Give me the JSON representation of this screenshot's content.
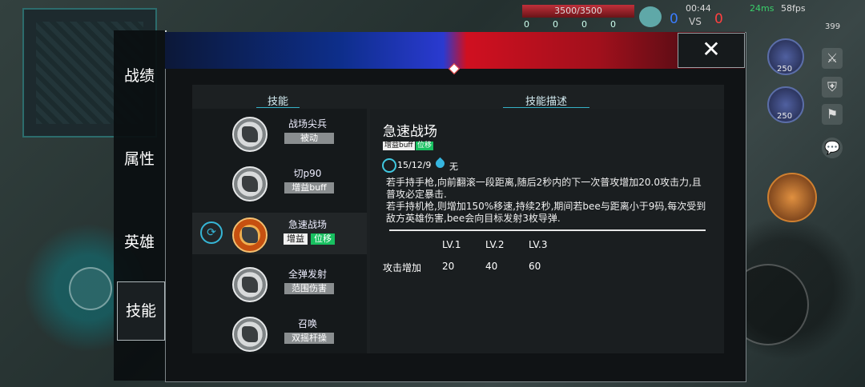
{
  "hud": {
    "hp": "3500/3500",
    "time": "00:44",
    "ping": "24ms",
    "fps": "58fps",
    "score_blue": "0",
    "vs": "VS",
    "score_red": "0",
    "stats": [
      "0",
      "0",
      "0",
      "0"
    ],
    "currency": "399",
    "hero1_level": "250",
    "hero2_level": "250"
  },
  "left_menu": {
    "items": [
      {
        "label": "战绩"
      },
      {
        "label": "属性"
      },
      {
        "label": "英雄"
      },
      {
        "label": "技能"
      }
    ]
  },
  "close_label": "✕",
  "tabs": {
    "skills": "技能",
    "description": "技能描述"
  },
  "skills": [
    {
      "name": "战场尖兵",
      "tags": [
        "被动"
      ]
    },
    {
      "name": "切p90",
      "tags": [
        "增益buff"
      ]
    },
    {
      "name": "急速战场",
      "tags": [
        "增益",
        "位移"
      ]
    },
    {
      "name": "全弹发射",
      "tags": [
        "范围伤害"
      ]
    },
    {
      "name": "召唤",
      "tags": [
        "双摇杆操"
      ]
    }
  ],
  "detail": {
    "title": "急速战场",
    "tags": [
      "增益buff",
      "位移"
    ],
    "cooldown": "15/12/9",
    "cost": "无",
    "description": "若手持手枪,向前翻滚一段距离,随后2秒内的下一次普攻增加20.0攻击力,且普攻必定暴击.\n若手持机枪,则增加150%移速,持续2秒,期间若bee与距离小于9码,每次受到敌方英雄伤害,bee会向目标发射3枚导弹.",
    "levels": [
      "LV.1",
      "LV.2",
      "LV.3"
    ],
    "stat_label": "攻击增加",
    "stat_values": [
      "20",
      "40",
      "60"
    ]
  }
}
